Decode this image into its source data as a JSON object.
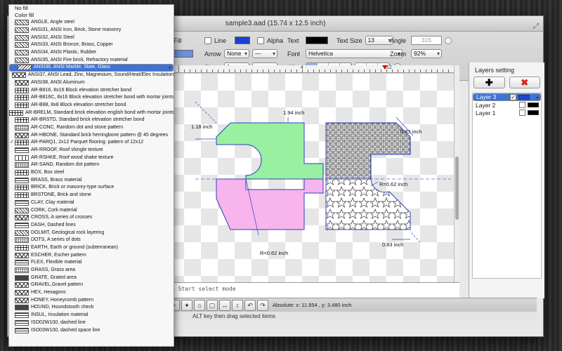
{
  "window": {
    "title": "sample3.aad (15.74 x 12.5 inch)",
    "resize_icon": "⤢"
  },
  "toolbar": {
    "fill_label": "Fill",
    "line_label": "Line",
    "arrow_label": "Arrow",
    "arrow_value": "None",
    "size_label": "Size",
    "size_value": "1",
    "alpha_label": "Alpha",
    "text_label": "Text",
    "text_size_label": "Text Size",
    "text_size_value": "13",
    "font_label": "Font",
    "font_value": "Helvetica",
    "align_label": "Align",
    "angle_label": "Angle",
    "angle_value": "315",
    "zoom_label": "Zoom",
    "zoom_value": "92%",
    "line_color": "#1a3fd6",
    "text_color": "#000000",
    "fill_color": "#6f8fd8"
  },
  "ruler": {
    "numbers": [
      "1",
      "4",
      "12"
    ]
  },
  "drawing": {
    "dim_top": "1.94 inch",
    "dim_left": "1.18 inch",
    "dim_right": "0.83 inch",
    "dim_r_right": "R=0.62 inch",
    "dim_bottom": "0.83 inch",
    "dim_r_bottom": "R=0.62 inch",
    "green": "#99f0a0",
    "pink": "#f8b4ec",
    "outline": "#3040c0"
  },
  "console": {
    "line1": "> Start select mode"
  },
  "bottombar": {
    "absolute": "Absolute: x: 11.954 , y: 3.480 inch",
    "buttons": [
      "+",
      "✦",
      "⌂",
      "▢",
      "↔",
      "↕",
      "↶",
      "↷"
    ]
  },
  "statusbar": {
    "text": "ALT key then drag selected items"
  },
  "layers": {
    "title": "Layers setting",
    "add_label": "✚",
    "delete_label": "✖",
    "items": [
      {
        "name": "Layer 3",
        "checked": "✓",
        "color": "#2046d8",
        "selected": true
      },
      {
        "name": "Layer 2",
        "checked": "",
        "color": "#000000",
        "selected": false
      },
      {
        "name": "Layer 1",
        "checked": "",
        "color": "#000000",
        "selected": false
      }
    ]
  },
  "menu": {
    "no_fill": "No fill",
    "color_fill": "Color fill",
    "items": [
      {
        "label": "ANGLE, Angle steel",
        "pat": "p-a",
        "sel": false,
        "ck": ""
      },
      {
        "label": "ANSI31, ANSI Iron, Brick, Stone masonry",
        "pat": "p-a",
        "sel": false,
        "ck": ""
      },
      {
        "label": "ANSI32, ANSI Steel",
        "pat": "p-a",
        "sel": false,
        "ck": ""
      },
      {
        "label": "ANSI33, ANSI Bronze, Brass, Copper",
        "pat": "p-a",
        "sel": false,
        "ck": ""
      },
      {
        "label": "ANSI34, ANSI Plastic, Rubber",
        "pat": "p-a",
        "sel": false,
        "ck": ""
      },
      {
        "label": "ANSI35, ANSI Fire brick, Refractory material",
        "pat": "p-a",
        "sel": false,
        "ck": ""
      },
      {
        "label": "ANSI36, ANSI Marble, Slate, Glass",
        "pat": "p-b",
        "sel": true,
        "ck": ""
      },
      {
        "label": "ANSI37, ANSI Lead, Zinc, Magnesium, Sound/Heat/Elec Insulation",
        "pat": "p-f",
        "sel": false,
        "ck": ""
      },
      {
        "label": "ANSI38, ANSI Aluminum",
        "pat": "p-f",
        "sel": false,
        "ck": ""
      },
      {
        "label": "AR-B816, 8x16 Block elevation stretcher bond",
        "pat": "p-c",
        "sel": false,
        "ck": ""
      },
      {
        "label": "AR-B816C, 8x16 Block elevation stretcher bond with mortar joints",
        "pat": "p-c",
        "sel": false,
        "ck": ""
      },
      {
        "label": "AR-B88, 8x8 Block elevation stretcher bond",
        "pat": "p-c",
        "sel": false,
        "ck": ""
      },
      {
        "label": "AR-BRELM, Standard brick elevation english bond with mortar joints",
        "pat": "p-c",
        "sel": false,
        "ck": ""
      },
      {
        "label": "AR-BRSTD, Standard brick elevation stretcher bond",
        "pat": "p-c",
        "sel": false,
        "ck": ""
      },
      {
        "label": "AR-CONC, Random dot and stone pattern",
        "pat": "p-e",
        "sel": false,
        "ck": ""
      },
      {
        "label": "AR-HBONE, Standard brick herringbone pattern @ 45 degrees",
        "pat": "p-f",
        "sel": false,
        "ck": ""
      },
      {
        "label": "AR-PARQ1, 2x12 Parquet flooring: pattern of 12x12",
        "pat": "p-c",
        "sel": false,
        "ck": "✓"
      },
      {
        "label": "AR-RROOF, Roof shingle texture",
        "pat": "p-d",
        "sel": false,
        "ck": ""
      },
      {
        "label": "AR-RSHKE, Roof wood shake texture",
        "pat": "p-i",
        "sel": false,
        "ck": ""
      },
      {
        "label": "AR-SAND, Random dot pattern",
        "pat": "p-e",
        "sel": false,
        "ck": ""
      },
      {
        "label": "BOX, Box steel",
        "pat": "p-c",
        "sel": false,
        "ck": ""
      },
      {
        "label": "BRASS, Brass material",
        "pat": "p-d",
        "sel": false,
        "ck": ""
      },
      {
        "label": "BRICK, Brick or masonry-type surface",
        "pat": "p-c",
        "sel": false,
        "ck": ""
      },
      {
        "label": "BRSTONE, Brick and stone",
        "pat": "p-c",
        "sel": false,
        "ck": ""
      },
      {
        "label": "CLAY, Clay material",
        "pat": "p-d",
        "sel": false,
        "ck": ""
      },
      {
        "label": "CORK, Cork material",
        "pat": "p-a",
        "sel": false,
        "ck": ""
      },
      {
        "label": "CROSS, A series of crosses",
        "pat": "p-f",
        "sel": false,
        "ck": ""
      },
      {
        "label": "DASH, Dashed lines",
        "pat": "p-d",
        "sel": false,
        "ck": ""
      },
      {
        "label": "DOLMIT, Geological rock layering",
        "pat": "p-a",
        "sel": false,
        "ck": ""
      },
      {
        "label": "DOTS, A series of dots",
        "pat": "p-e",
        "sel": false,
        "ck": ""
      },
      {
        "label": "EARTH, Earth or ground (subterranean)",
        "pat": "p-c",
        "sel": false,
        "ck": ""
      },
      {
        "label": "ESCHER, Escher pattern",
        "pat": "p-f",
        "sel": false,
        "ck": ""
      },
      {
        "label": "FLEX, Flexible material",
        "pat": "p-d",
        "sel": false,
        "ck": ""
      },
      {
        "label": "GRASS, Grass area",
        "pat": "p-e",
        "sel": false,
        "ck": ""
      },
      {
        "label": "GRATE, Grated area",
        "pat": "p-h",
        "sel": false,
        "ck": ""
      },
      {
        "label": "GRAVEL,Gravel pattern",
        "pat": "p-f",
        "sel": false,
        "ck": ""
      },
      {
        "label": "HEX, Hexagons",
        "pat": "p-f",
        "sel": false,
        "ck": ""
      },
      {
        "label": "HONEY, Honeycomb pattern",
        "pat": "p-f",
        "sel": false,
        "ck": ""
      },
      {
        "label": "HOUND, Houndstooth check",
        "pat": "p-h",
        "sel": false,
        "ck": ""
      },
      {
        "label": "INSUL, Insulation material",
        "pat": "p-d",
        "sel": false,
        "ck": ""
      },
      {
        "label": "ISO02W100, dashed line",
        "pat": "p-d",
        "sel": false,
        "ck": ""
      },
      {
        "label": "ISO03W100, dashed space line",
        "pat": "p-d",
        "sel": false,
        "ck": ""
      }
    ]
  }
}
